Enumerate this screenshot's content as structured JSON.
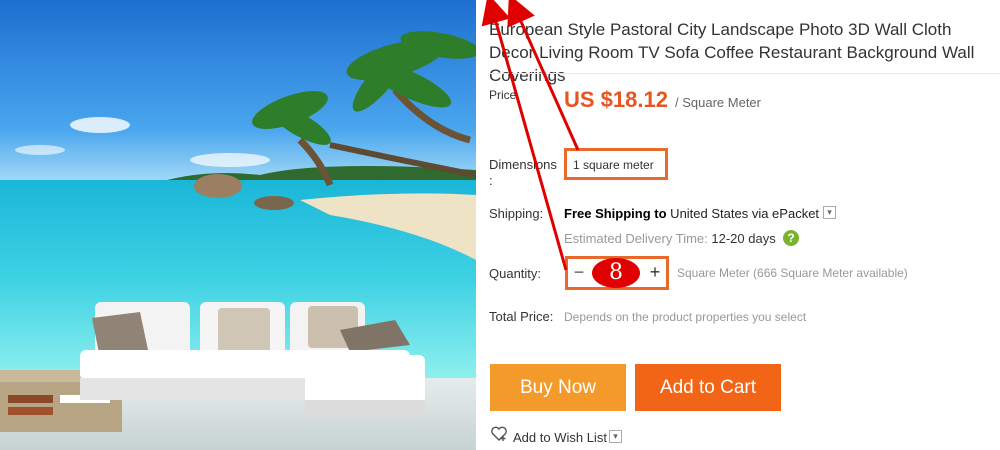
{
  "product": {
    "title": "European Style Pastoral City Landscape Photo 3D Wall Cloth Decor Living Room TV Sofa Coffee Restaurant Background Wall Coverings",
    "image_alt": "Beach mural with palm trees behind a white sectional sofa"
  },
  "price": {
    "label": "Price",
    "amount": "US $18.12",
    "unit": "/ Square Meter"
  },
  "dimensions": {
    "label": "Dimensions :",
    "selected": "1 square meter"
  },
  "shipping": {
    "label": "Shipping:",
    "free": "Free Shipping to",
    "destination": " United States via ePacket",
    "delivery_label": "Estimated Delivery Time:",
    "delivery_days": " 12-20 days"
  },
  "quantity": {
    "label": "Quantity:",
    "minus": "−",
    "value": "8",
    "plus": "+",
    "note": "Square Meter (666 Square Meter available)"
  },
  "total": {
    "label": "Total Price:",
    "text": "Depends on the product properties you select"
  },
  "actions": {
    "buy_now": "Buy Now",
    "add_to_cart": "Add to Cart",
    "wishlist": "Add to Wish List"
  },
  "colors": {
    "price": "#e95420",
    "buy_now": "#f39a2a",
    "add_to_cart": "#f26416",
    "annotation": "#e00000",
    "highlight_box": "#e86a2b"
  }
}
